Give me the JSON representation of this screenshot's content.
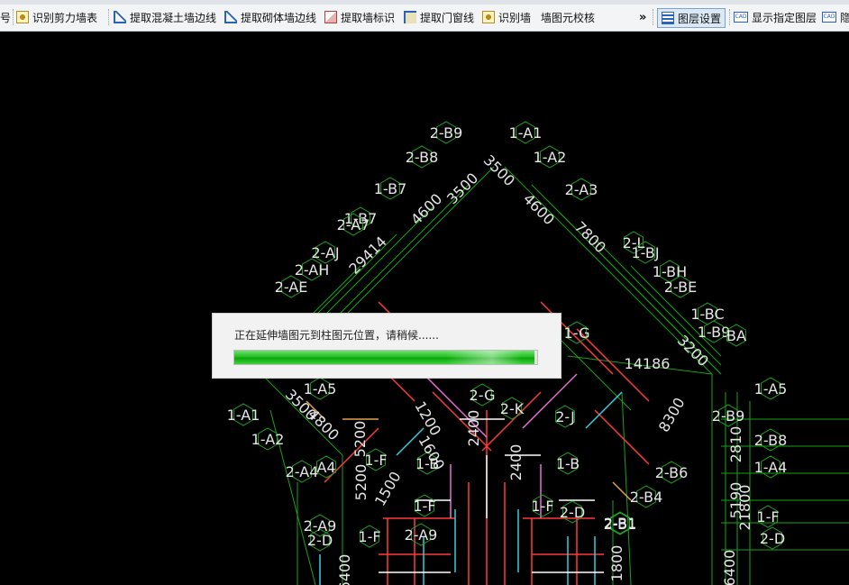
{
  "toolbar": {
    "items": [
      {
        "label": "号"
      },
      {
        "label": "识别剪力墙表"
      },
      {
        "label": "提取混凝土墙边线"
      },
      {
        "label": "提取砌体墙边线"
      },
      {
        "label": "提取墙标识"
      },
      {
        "label": "提取门窗线"
      },
      {
        "label": "识别墙"
      },
      {
        "label": "墙图元校核"
      },
      {
        "label": "图层设置"
      },
      {
        "label": "显示指定图层"
      },
      {
        "label": "隐"
      }
    ],
    "overflow_glyph": "»"
  },
  "dialog": {
    "message": "正在延伸墙图元到柱图元位置，请稍候......",
    "progress": 0.99
  },
  "drawing": {
    "axis_labels": [
      {
        "text": "2-B9"
      },
      {
        "text": "1-A1"
      },
      {
        "text": "2-B8"
      },
      {
        "text": "1-A2"
      },
      {
        "text": "1-B7"
      },
      {
        "text": "2-A3"
      },
      {
        "text": "1-B7"
      },
      {
        "text": "2-A7"
      },
      {
        "text": "2-AJ"
      },
      {
        "text": "2-AH"
      },
      {
        "text": "2-AE"
      },
      {
        "text": "2-L"
      },
      {
        "text": "1-BJ"
      },
      {
        "text": "1-BH"
      },
      {
        "text": "2-BE"
      },
      {
        "text": "1-BC"
      },
      {
        "text": "1-B9"
      },
      {
        "text": "BA"
      },
      {
        "text": "1-G"
      },
      {
        "text": "1-A5"
      },
      {
        "text": "1-A1"
      },
      {
        "text": "1-A2"
      },
      {
        "text": "2-A4"
      },
      {
        "text": "A4"
      },
      {
        "text": "2-G"
      },
      {
        "text": "2-K"
      },
      {
        "text": "2-J"
      },
      {
        "text": "1-A5"
      },
      {
        "text": "2-B9"
      },
      {
        "text": "2-B8"
      },
      {
        "text": "1-A4"
      },
      {
        "text": "2-B6"
      },
      {
        "text": "2-B4"
      },
      {
        "text": "2-B1"
      },
      {
        "text": "2-D"
      },
      {
        "text": "1-F"
      },
      {
        "text": "1-B"
      },
      {
        "text": "1-B"
      },
      {
        "text": "1-F"
      },
      {
        "text": "1-F"
      },
      {
        "text": "1-F"
      },
      {
        "text": "2-A9"
      },
      {
        "text": "2-B1"
      },
      {
        "text": "2-D"
      },
      {
        "text": "1-F"
      },
      {
        "text": "2-A9"
      },
      {
        "text": "2-D"
      }
    ],
    "dimensions": [
      {
        "text": "3500"
      },
      {
        "text": "4600"
      },
      {
        "text": "3500"
      },
      {
        "text": "4600"
      },
      {
        "text": "7800"
      },
      {
        "text": "29414"
      },
      {
        "text": "14186"
      },
      {
        "text": "3200"
      },
      {
        "text": "8300"
      },
      {
        "text": "1200"
      },
      {
        "text": "1600"
      },
      {
        "text": "2400"
      },
      {
        "text": "2400"
      },
      {
        "text": "1500"
      },
      {
        "text": "3500"
      },
      {
        "text": "4800"
      },
      {
        "text": "5200"
      },
      {
        "text": "5200"
      },
      {
        "text": "2810"
      },
      {
        "text": "5190"
      },
      {
        "text": "21800"
      },
      {
        "text": "1800"
      },
      {
        "text": "6400"
      },
      {
        "text": "6400"
      }
    ]
  }
}
